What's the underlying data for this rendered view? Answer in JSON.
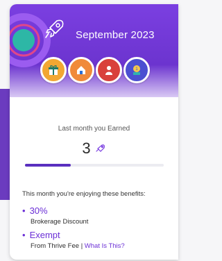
{
  "header": {
    "month": "September 2023"
  },
  "earned": {
    "label": "Last month you Earned",
    "value": "3"
  },
  "progress": {
    "fraction": 0.33
  },
  "benefits": {
    "intro": "This month you're enjoying these benefits:",
    "items": [
      {
        "value": "30%",
        "desc": "Brokerage Discount"
      },
      {
        "value": "Exempt",
        "desc": "From Thrive Fee",
        "separator": "|",
        "link": "What Is This?"
      }
    ]
  },
  "colors": {
    "accent": "#6b2fd6",
    "header": "#7b3fe1"
  },
  "icons": [
    "rocket-icon",
    "gift-icon",
    "home-icon",
    "person-icon",
    "medal-icon",
    "small-rocket-icon"
  ]
}
